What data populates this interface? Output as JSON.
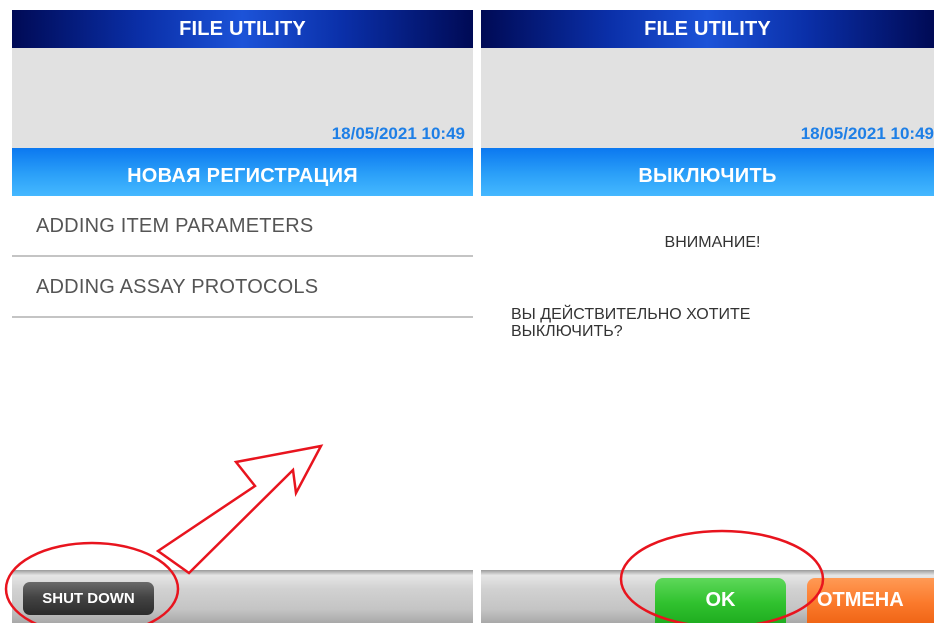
{
  "left_screen": {
    "title": "FILE UTILITY",
    "datetime": "18/05/2021 10:49",
    "section_title": "НОВАЯ РЕГИСТРАЦИЯ",
    "menu_items": [
      {
        "label": "ADDING ITEM PARAMETERS"
      },
      {
        "label": "ADDING ASSAY PROTOCOLS"
      }
    ],
    "shutdown_label": "SHUT DOWN"
  },
  "right_screen": {
    "title": "FILE UTILITY",
    "datetime": "18/05/2021 10:49",
    "section_title": "ВЫКЛЮЧИТЬ",
    "warning": "ВНИМАНИЕ!",
    "question": "ВЫ ДЕЙСТВИТЕЛЬНО ХОТИТЕ ВЫКЛЮЧИТЬ?",
    "ok_label": "OK",
    "cancel_label": "ОТМЕНА"
  },
  "colors": {
    "title_bar": "#0a2fa8",
    "section_bar": "#2ba0f8",
    "datetime": "#1e7fe6",
    "ok_button": "#31c22f",
    "cancel_button": "#fb7a2c",
    "shutdown_button": "#444444",
    "annotation": "#e8141e"
  },
  "annotations": {
    "arrow": "red-arrow-icon",
    "highlight": "red-ellipse-icon"
  }
}
